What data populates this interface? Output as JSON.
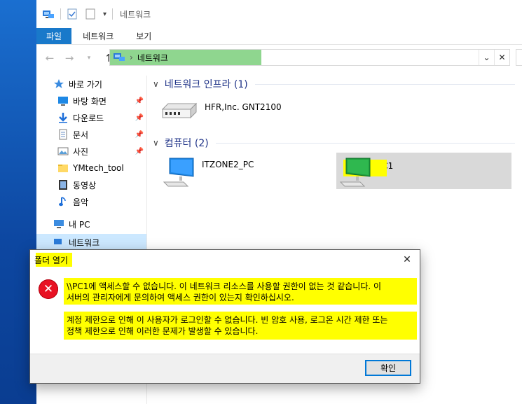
{
  "window": {
    "title": "네트워크",
    "ribbon_tabs": [
      "파일",
      "네트워크",
      "보기"
    ]
  },
  "address_bar": {
    "path": "네트워크",
    "dropdown_icon": "chevron-down-icon",
    "close_icon": "close-icon"
  },
  "sidebar": {
    "quick_access": "바로 가기",
    "items": [
      {
        "label": "바탕 화면",
        "icon": "desktop-icon",
        "pinned": true
      },
      {
        "label": "다운로드",
        "icon": "download-icon",
        "pinned": true
      },
      {
        "label": "문서",
        "icon": "document-icon",
        "pinned": true
      },
      {
        "label": "사진",
        "icon": "picture-icon",
        "pinned": true
      },
      {
        "label": "YMtech_tool",
        "icon": "folder-icon",
        "pinned": false
      },
      {
        "label": "동영상",
        "icon": "video-icon",
        "pinned": false
      },
      {
        "label": "음악",
        "icon": "music-icon",
        "pinned": false
      }
    ],
    "this_pc": "내 PC",
    "network": "네트워크"
  },
  "content": {
    "groups": [
      {
        "header": "네트워크 인프라 (1)",
        "items": [
          {
            "name": "HFR,Inc. GNT2100",
            "icon": "router-icon"
          }
        ]
      },
      {
        "header": "컴퓨터 (2)",
        "items": [
          {
            "name": "ITZONE2_PC",
            "icon": "computer-icon"
          },
          {
            "name": "PC1",
            "icon": "computer-icon",
            "selected": true
          }
        ]
      }
    ]
  },
  "dialog": {
    "title": "폴더 열기",
    "line1": "\\\\PC1에 액세스할 수 없습니다. 이 네트워크 리소스를 사용할 권한이 없는 것 같습니다. 이",
    "line2": "서버의 관리자에게 문의하여 액세스 권한이 있는지 확인하십시오.",
    "line3": "계정 제한으로 인해 이 사용자가 로그인할 수 없습니다. 빈 암호 사용, 로그온 시간 제한 또는",
    "line4": "정책 제한으로 인해 이러한 문제가 발생할 수 있습니다.",
    "ok_button": "확인",
    "error_icon": "error-icon"
  },
  "colors": {
    "accent": "#1979ca",
    "highlight_yellow": "#ffff00",
    "address_highlight": "#8fd68f",
    "group_header": "#1e3287"
  }
}
